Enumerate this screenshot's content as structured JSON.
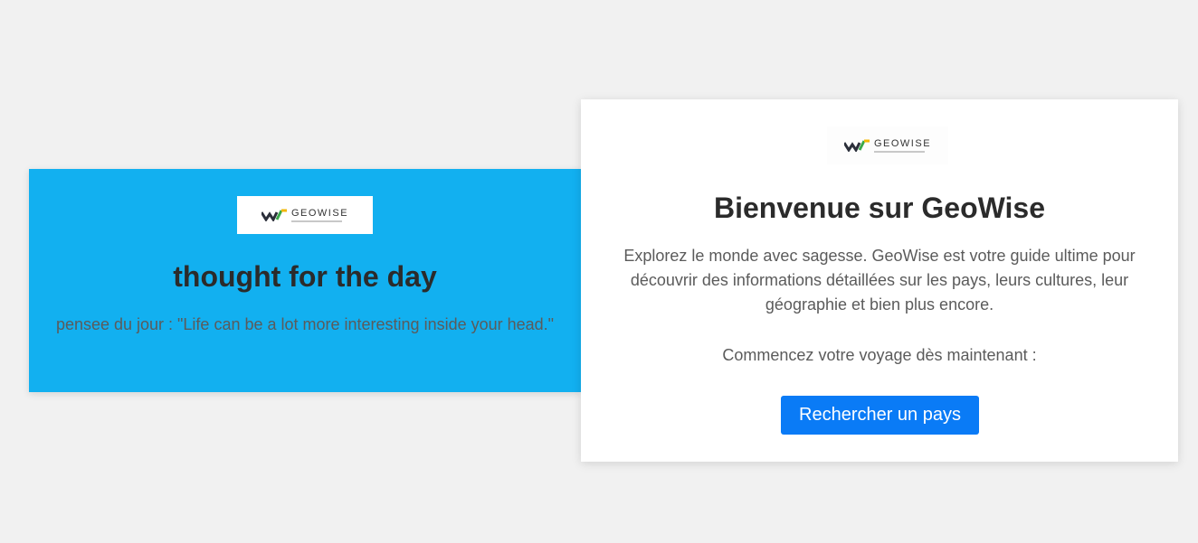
{
  "quote_card": {
    "logo_text": "GEOWISE",
    "title": "thought for the day",
    "quote": "pensee du jour : \"Life can be a lot more interesting inside your head.\""
  },
  "welcome_card": {
    "logo_text": "GEOWISE",
    "title": "Bienvenue sur GeoWise",
    "description": "Explorez le monde avec sagesse. GeoWise est votre guide ultime pour découvrir des informations détaillées sur les pays, leurs cultures, leur géographie et bien plus encore.",
    "cta_text": "Commencez votre voyage dès maintenant :",
    "button_label": "Rechercher un pays"
  },
  "colors": {
    "page_background": "#f1f1f1",
    "quote_card_background": "#12b0f0",
    "button_background": "#0a7bf6",
    "logo_dark": "#2b2f3a",
    "logo_green": "#3aa84a",
    "logo_yellow": "#f2b705"
  }
}
